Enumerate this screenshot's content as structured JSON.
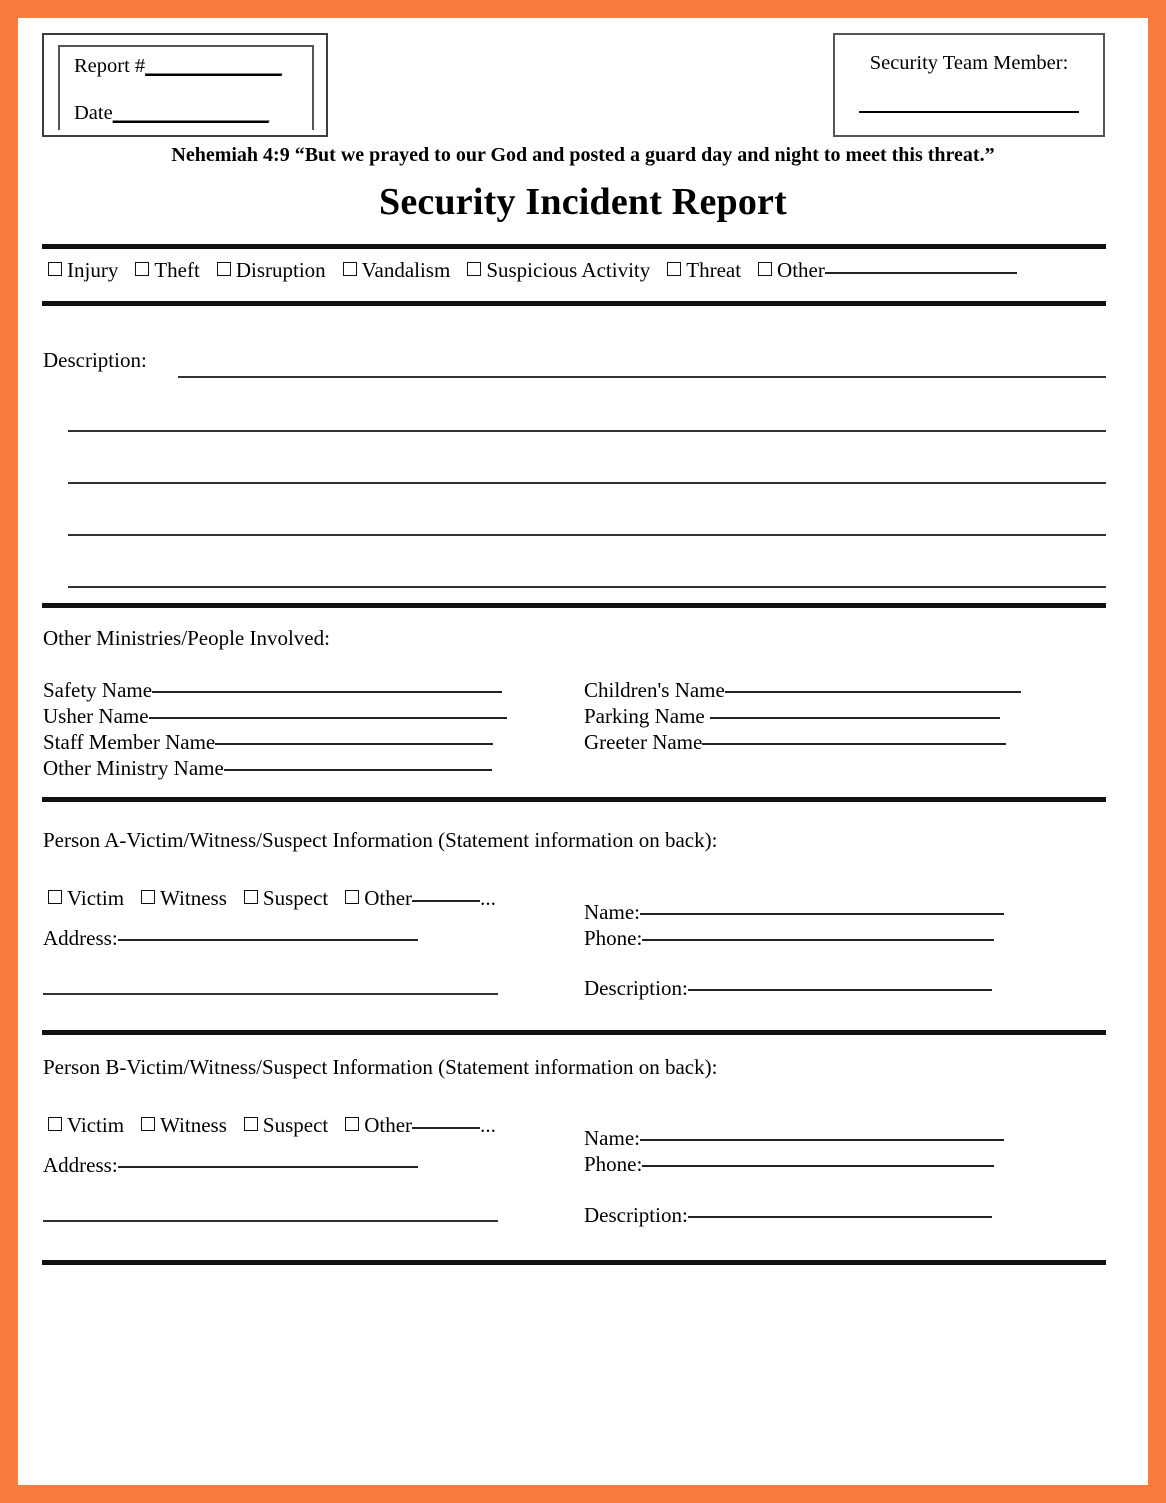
{
  "theme": {
    "border_color": "#f97b3d",
    "page_color": "#ffffff",
    "ink_color": "#000000"
  },
  "header": {
    "report_number_label": "Report #",
    "report_number_blank": "______________",
    "date_label": "Date",
    "date_blank": "________________",
    "security_team_member_label": "Security Team Member:"
  },
  "scripture": "Nehemiah 4:9 “But we prayed to our God and posted a guard day and night to meet this threat.”",
  "title": "Security Incident Report",
  "incident_types": [
    {
      "label": "Injury"
    },
    {
      "label": "Theft"
    },
    {
      "label": "Disruption"
    },
    {
      "label": "Vandalism"
    },
    {
      "label": "Suspicious Activity"
    },
    {
      "label": "Threat"
    },
    {
      "label": "Other"
    }
  ],
  "description": {
    "label": "Description:",
    "blank_lines": 4
  },
  "ministries": {
    "heading": "Other Ministries/People Involved:",
    "left_fields": [
      {
        "label": "Safety Name"
      },
      {
        "label": "Usher Name"
      },
      {
        "label": "Staff Member Name"
      },
      {
        "label": "Other Ministry Name"
      }
    ],
    "right_fields": [
      {
        "label": "Children's Name"
      },
      {
        "label": "Parking Name "
      },
      {
        "label": "Greeter Name"
      }
    ]
  },
  "person_a": {
    "heading": "Person A-Victim/Witness/Suspect Information (Statement information on back):",
    "roles": [
      {
        "label": "Victim"
      },
      {
        "label": "Witness"
      },
      {
        "label": "Suspect"
      },
      {
        "label": "Other"
      }
    ],
    "other_suffix": "...",
    "address_label": "Address:",
    "name_label": "Name:",
    "phone_label": "Phone:",
    "description_label": "Description:"
  },
  "person_b": {
    "heading": "Person B-Victim/Witness/Suspect Information (Statement information on back):",
    "roles": [
      {
        "label": "Victim"
      },
      {
        "label": "Witness"
      },
      {
        "label": "Suspect"
      },
      {
        "label": "Other"
      }
    ],
    "other_suffix": "...",
    "address_label": "Address:",
    "name_label": "Name:",
    "phone_label": "Phone:",
    "description_label": "Description:"
  }
}
